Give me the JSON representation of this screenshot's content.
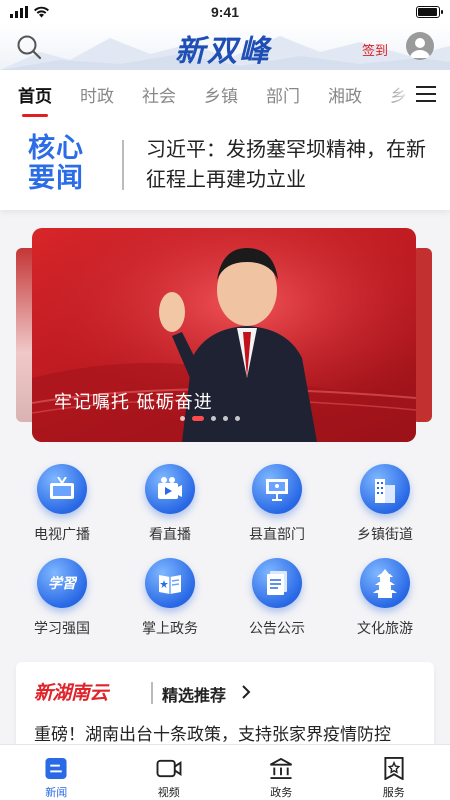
{
  "status_bar": {
    "time": "9:41",
    "battery_level": 0.95
  },
  "header": {
    "logo_text": "新双峰",
    "signin_label": "签到"
  },
  "tabs": [
    {
      "label": "首页",
      "active": true
    },
    {
      "label": "时政"
    },
    {
      "label": "社会"
    },
    {
      "label": "乡镇"
    },
    {
      "label": "部门"
    },
    {
      "label": "湘政"
    },
    {
      "label": "乡"
    }
  ],
  "core_news": {
    "label_line1": "核心",
    "label_line2": "要闻",
    "headline": "习近平：发扬塞罕坝精神，在新征程上再建功立业"
  },
  "carousel": {
    "banner_title": "牢记嘱托 砥砺奋进",
    "dot_count": 5,
    "active_dot": 1
  },
  "services": [
    {
      "label": "电视广播",
      "icon": "tv-icon"
    },
    {
      "label": "看直播",
      "icon": "live-icon"
    },
    {
      "label": "县直部门",
      "icon": "department-icon"
    },
    {
      "label": "乡镇街道",
      "icon": "building-icon"
    },
    {
      "label": "学习强国",
      "icon": "xuexi-icon"
    },
    {
      "label": "掌上政务",
      "icon": "handbook-icon"
    },
    {
      "label": "公告公示",
      "icon": "notice-icon"
    },
    {
      "label": "文化旅游",
      "icon": "pagoda-icon"
    }
  ],
  "recommend": {
    "brand": "新湖南云",
    "title": "精选推荐",
    "headline": "重磅！湖南出台十条政策，支持张家界疫情防控"
  },
  "bottom_nav": [
    {
      "label": "新闻",
      "icon": "news-icon",
      "active": true
    },
    {
      "label": "视频",
      "icon": "video-icon"
    },
    {
      "label": "政务",
      "icon": "government-icon"
    },
    {
      "label": "服务",
      "icon": "service-icon"
    }
  ],
  "colors": {
    "accent_blue": "#2a6ae6",
    "accent_red": "#e02020",
    "banner_red": "#c81e24"
  }
}
